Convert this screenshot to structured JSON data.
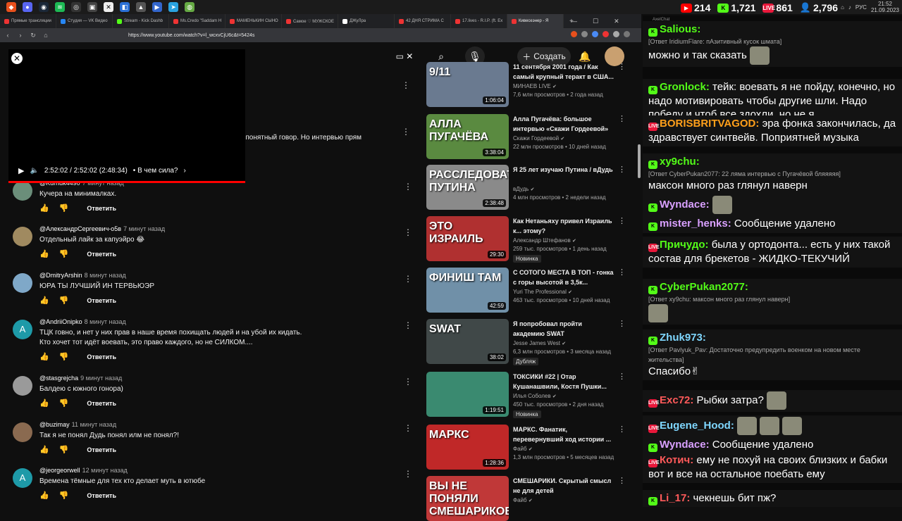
{
  "taskbar": {
    "tray": {
      "lang": "РУС",
      "time": "21:52",
      "date": "21.09.2023"
    }
  },
  "stream_stats": {
    "youtube_viewers": "214",
    "kick_viewers": "1,721",
    "twitch_viewers": "861",
    "total_viewers": "2,796"
  },
  "browser": {
    "tabs": [
      {
        "label": "Прямые трансляции",
        "color": "#e33"
      },
      {
        "label": "Студия — VK Видео",
        "color": "#2787f5"
      },
      {
        "label": "Stream - Kick Dashb",
        "color": "#53fc18"
      },
      {
        "label": "Ms.Credo \"Saddam H",
        "color": "#e33"
      },
      {
        "label": "МАМЕНЬКИН СЫНО",
        "color": "#e33"
      },
      {
        "label": "Самое ♡ МУЖСКОЕ",
        "color": "#e33"
      },
      {
        "label": "ДЖуЛра",
        "color": "#fff"
      },
      {
        "label": "42 ДНЯ СТРИМА С",
        "color": "#e33"
      },
      {
        "label": "17.lives - R.I.P. (ft. Ex",
        "color": "#e33"
      },
      {
        "label": "Кивесеэнер - Я",
        "color": "#e33",
        "active": true
      }
    ],
    "url": "https://www.youtube.com/watch?v=l_wcxvCjU6c&t=5424s",
    "add_tab": "+"
  },
  "yt_header": {
    "create_label": "Создать"
  },
  "miniplayer": {
    "time": "2:52:02 / 2:52:02 (2:48:34)",
    "chapter": "• В чем сила?",
    "progress": 1.0
  },
  "comments": {
    "partial_text": "е понятный говор. Но интервью прям",
    "reply_label": "Ответить",
    "items": [
      {
        "author": "@Kurnuk4490",
        "time": "7 минут назад",
        "text": "Кучера на минималках.",
        "avatar_color": "#6b8e7a"
      },
      {
        "author": "@АлександрСергеевич-о5в",
        "time": "7 минут назад",
        "text": "Отдельный лайк за капуэйро 😂",
        "avatar_color": "#a08a60"
      },
      {
        "author": "@DmitryArshin",
        "time": "8 минут назад",
        "text": "ЮРА ТЫ ЛУЧШИЙ ИН ТЕРВЬЮЭР",
        "avatar_color": "#7fa8c8"
      },
      {
        "author": "@AndriiOnipko",
        "time": "8 минут назад",
        "text": "ТЦК говно, и нет у них прав в наше время похищать людей и на убой их кидать.",
        "text2": "Кто хочет тот идёт воевать, это право каждого, но не СИЛКОМ....",
        "avatar_letter": "A",
        "avatar_color": "#1e9aa8"
      },
      {
        "author": "@stasgrejcha",
        "time": "9 минут назад",
        "text": "Балдею с южного гонора)",
        "avatar_color": "#9a9a9a"
      },
      {
        "author": "@buzimay",
        "time": "11 минут назад",
        "text": "Так я не понял Дудь понял илм не понял?!",
        "avatar_color": "#8a6a50"
      },
      {
        "author": "@jeorgeorwell",
        "time": "12 минут назад",
        "text": "Времена тёмные для тех кто делает муть в ютюбе",
        "avatar_letter": "A",
        "avatar_color": "#1e9aa8"
      }
    ]
  },
  "recommendations": [
    {
      "title": "11 сентября 2001 года / Как самый крупный теракт в США...",
      "channel": "МИНАЕВ LIVE",
      "meta": "7,6 млн просмотров • 2 года назад",
      "duration": "1:06:04",
      "thumb_text": "9/11",
      "thumb_color": "#6a7a90"
    },
    {
      "title": "Алла Пугачёва: большое интервью «Скажи Гордеевой»",
      "channel": "Скажи Гордеевой",
      "meta": "22 млн просмотров • 10 дней назад",
      "duration": "3:38:04",
      "thumb_text": "АЛЛА ПУГАЧЁВА",
      "thumb_color": "#5a8a40"
    },
    {
      "title": "Я 25 лет изучаю Путина / вДудь",
      "channel": "вДудь",
      "meta": "4 млн просмотров • 2 недели назад",
      "duration": "2:38:48",
      "thumb_text": "РАССЛЕДОВАТЕЛЬ ПУТИНА",
      "thumb_color": "#8a8a8a"
    },
    {
      "title": "Как Нетаньяху привел Израиль к... этому?",
      "channel": "Александр Штефанов",
      "meta": "259 тыс. просмотров • 1 день назад",
      "duration": "29:30",
      "badge": "Новинка",
      "thumb_text": "ЭТО ИЗРАИЛЬ",
      "thumb_color": "#b03030"
    },
    {
      "title": "С СОТОГО МЕСТА В ТОП - гонка с горы высотой в 3,5к...",
      "channel": "Yuri The Professional",
      "meta": "463 тыс. просмотров • 10 дней назад",
      "duration": "42:59",
      "thumb_text": "ФИНИШ ТАМ",
      "thumb_color": "#7090a8"
    },
    {
      "title": "Я попробовал пройти академию SWAT",
      "channel": "Jesse James West",
      "meta": "6,3 млн просмотров • 3 месяца назад",
      "duration": "38:02",
      "badge": "Дубляж",
      "thumb_text": "SWAT",
      "thumb_color": "#404848"
    },
    {
      "title": "ТОКСИКИ #22 | Отар Кушанашвили, Костя Пушки...",
      "channel": "Илья Соболев",
      "meta": "450 тыс. просмотров • 2 дня назад",
      "duration": "1:19:51",
      "badge": "Новинка",
      "thumb_text": "",
      "thumb_color": "#3a8a70"
    },
    {
      "title": "МАРКС. Фанатик, перевернувший ход истории ...",
      "channel": "Файб",
      "meta": "1,3 млн просмотров • 5 месяцев назад",
      "duration": "1:28:36",
      "thumb_text": "МАРКС",
      "thumb_color": "#c02828"
    },
    {
      "title": "СМЕШАРИКИ. Скрытый смысл не для детей",
      "channel": "Файб",
      "meta": "",
      "duration": "",
      "thumb_text": "ВЫ НЕ ПОНЯЛИ СМЕШАРИКОВ",
      "thumb_color": "#c03838"
    }
  ],
  "chat": {
    "app_name": "AxelChat",
    "messages": [
      {
        "platform": "k",
        "user": "Salious:",
        "color": "#53fc18",
        "reply": "[Ответ IridiumFlare: пАзитивный кусок шмата]",
        "text": "можно и так сказать"
      },
      {
        "platform": "k",
        "user": "Gronlock:",
        "color": "#53fc18",
        "text": "тейк: воевать я не пойду, конечно, но надо мотивировать чтобы другие шли. Надо победу и чтоб все здохли, но не я"
      },
      {
        "platform": "live",
        "user": "BORISBRITVAGOD:",
        "color": "#ff9f1a",
        "text": "эра фонка закончилась, да здравствует синтвейв. Поприятней музыка"
      },
      {
        "platform": "k",
        "user": "xy9chu:",
        "color": "#53fc18",
        "reply": "[Ответ CyberPukan2077: 22 ляма интервью с Пугачёвой бляяяяя]",
        "text": "максон много раз глянул наверн"
      },
      {
        "platform": "k",
        "user": "Wyndace:",
        "color": "#d9a0ff",
        "text": ""
      },
      {
        "platform": "k",
        "user": "mister_henks:",
        "color": "#d9a0ff",
        "text": "Сообщение удалено"
      },
      {
        "platform": "live",
        "user": "Причудо:",
        "color": "#53fc18",
        "text": "была у ортодонта... есть у них такой состав для брекетов - ЖИДКО-ТЕКУЧИЙ"
      },
      {
        "platform": "k",
        "user": "CyberPukan2077:",
        "color": "#53fc18",
        "reply": "[Ответ xy9chu: максон много раз глянул наверн]",
        "text": ""
      },
      {
        "platform": "k",
        "user": "Zhuk973:",
        "color": "#7fd7ff",
        "reply": "[Ответ Pavlyuk_Pav: Достаточно предупредить военком на новом месте жительства]",
        "text": "Спасибо✌"
      },
      {
        "platform": "live",
        "user": "Exc72:",
        "color": "#ff5a5a",
        "text": "Рыбки затра?"
      },
      {
        "platform": "live",
        "user": "Eugene_Hood:",
        "color": "#7fd7ff",
        "text": ""
      },
      {
        "platform": "k",
        "user": "Wyndace:",
        "color": "#d9a0ff",
        "text": "Сообщение удалено"
      },
      {
        "platform": "live",
        "user": "Котич:",
        "color": "#ff5a5a",
        "text": "ему не похуй на своих близких и бабки вот и все  на остальное поебать ему"
      },
      {
        "platform": "k",
        "user": "Li_17:",
        "color": "#ff5a5a",
        "text": "чекнешь бит пж?"
      }
    ]
  },
  "colors": {
    "yt_bg": "#0f0f0f",
    "yt_red": "#ff0000",
    "kick_green": "#53fc18",
    "live_red": "#e9183b"
  }
}
